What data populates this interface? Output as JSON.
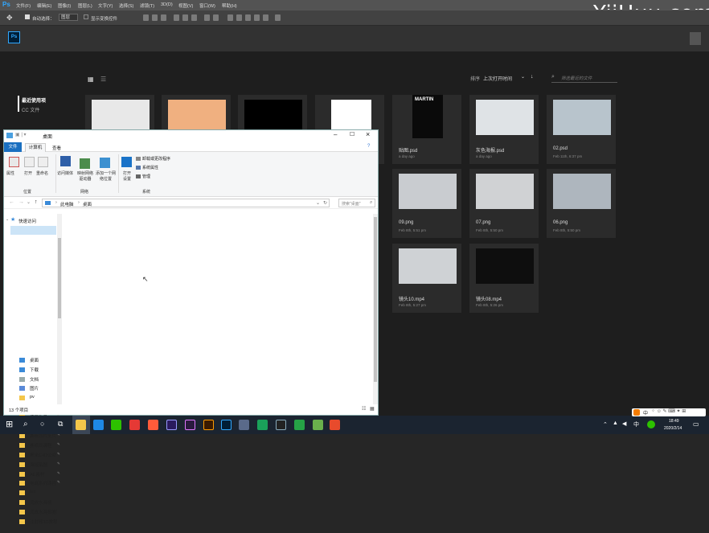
{
  "ps": {
    "logo": "Ps",
    "menu": [
      "文件(F)",
      "编辑(E)",
      "图像(I)",
      "图层(L)",
      "文字(Y)",
      "选择(S)",
      "滤镜(T)",
      "3D(D)",
      "视图(V)",
      "窗口(W)",
      "帮助(H)"
    ],
    "options": {
      "auto_select": "自动选择：",
      "layer_select": "图层",
      "show_transform": "显示变换控件"
    },
    "home": {
      "recent_title": "最近使用项",
      "cc_files": "CC 文件",
      "sort_label": "排序",
      "sort_value": "上次打开时间",
      "search_placeholder": "筛选最近的文件"
    },
    "cards": [
      {
        "name": "贴图.psd",
        "date": "a day ago"
      },
      {
        "name": "灰色海报.psd",
        "date": "a day ago"
      },
      {
        "name": "02.psd",
        "date": "Feb 11th, 6:37 pm"
      },
      {
        "name": "09.png",
        "date": "Feb 8th, 5:51 pm"
      },
      {
        "name": "07.png",
        "date": "Feb 8th, 5:50 pm"
      },
      {
        "name": "06.png",
        "date": "Feb 8th, 5:50 pm"
      },
      {
        "name": "镜头10.mp4",
        "date": "Feb 8th, 5:27 pm"
      },
      {
        "name": "镜头08.mp4",
        "date": "Feb 8th, 5:26 pm"
      }
    ],
    "martin": "MARTIN"
  },
  "watermark": "YiiHuu.com",
  "explorer": {
    "title": "桌面",
    "tabs": [
      "文件",
      "计算机",
      "查看"
    ],
    "ribbon": {
      "properties": "属性",
      "open": "打开",
      "rename": "重命名",
      "access_media": "访问媒体",
      "map_drive": "映射网络驱动器",
      "add_location": "添加一个网络位置",
      "open_settings": "打开设置",
      "uninstall": "卸载或更改程序",
      "sys_props": "系统属性",
      "manage": "管理",
      "group_location": "位置",
      "group_network": "网络",
      "group_system": "系统"
    },
    "address": [
      "此电脑",
      "桌面"
    ],
    "search_placeholder": "搜索\"桌面\"",
    "nav": {
      "quick_access": "快速访问",
      "items": [
        "桌面",
        "下载",
        "文档",
        "图片",
        "pv",
        "教程",
        "练习作品",
        "MAXON",
        "撕纸同片头片",
        "撕纸同课程",
        "黑米C4D公众",
        "海报贴图",
        "AE素材",
        "电商系列课程",
        "tex",
        "流放水海报",
        "流放水海报教程",
        "注射器3D教程"
      ]
    },
    "status": "13 个项目"
  },
  "taskbar": {
    "time": "18:49",
    "date": "2020/2/14",
    "lang": "中"
  }
}
